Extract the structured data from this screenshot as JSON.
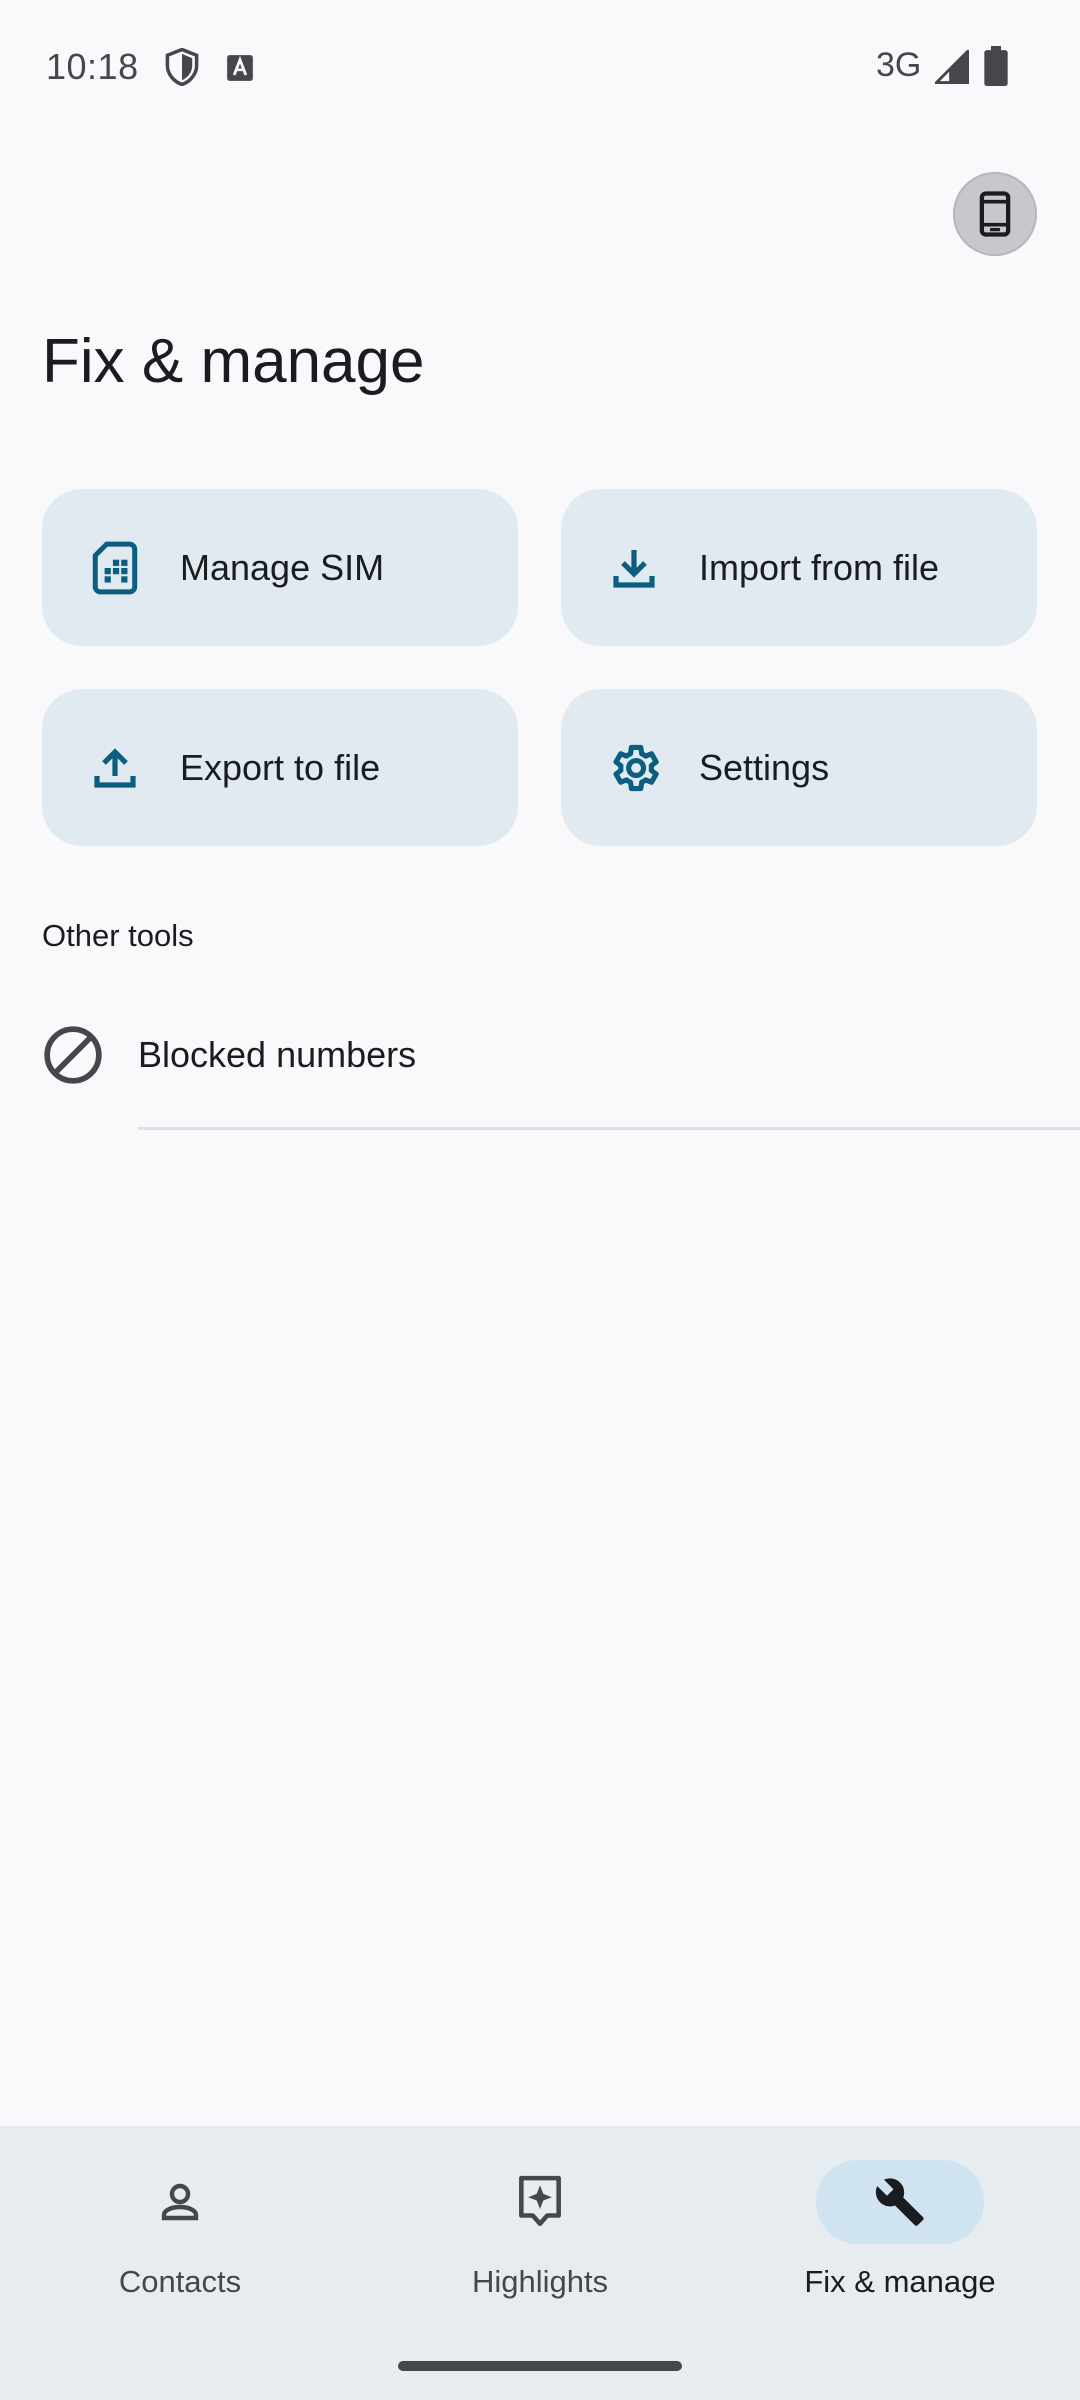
{
  "status_bar": {
    "time": "10:18",
    "network": "3G",
    "icons": [
      "shield-icon",
      "keyboard-a-icon",
      "signal-icon",
      "battery-icon"
    ]
  },
  "header": {
    "device_button_icon": "phone-device-icon"
  },
  "page": {
    "title": "Fix & manage"
  },
  "cards": [
    {
      "label": "Manage SIM",
      "icon": "sim-card-icon"
    },
    {
      "label": "Import from file",
      "icon": "download-icon"
    },
    {
      "label": "Export to file",
      "icon": "upload-icon"
    },
    {
      "label": "Settings",
      "icon": "gear-icon"
    }
  ],
  "other_tools": {
    "heading": "Other tools",
    "items": [
      {
        "label": "Blocked numbers",
        "icon": "block-icon"
      }
    ]
  },
  "bottom_nav": {
    "items": [
      {
        "label": "Contacts",
        "icon": "person-icon",
        "active": false
      },
      {
        "label": "Highlights",
        "icon": "sparkle-icon",
        "active": false
      },
      {
        "label": "Fix & manage",
        "icon": "wrench-icon",
        "active": true
      }
    ]
  },
  "colors": {
    "background": "#F9F9FC",
    "card": "#E0EAF0",
    "accent_icon": "#0B5E80",
    "nav_background": "#E7ECF1",
    "nav_active_pill": "#CFE3F1"
  }
}
